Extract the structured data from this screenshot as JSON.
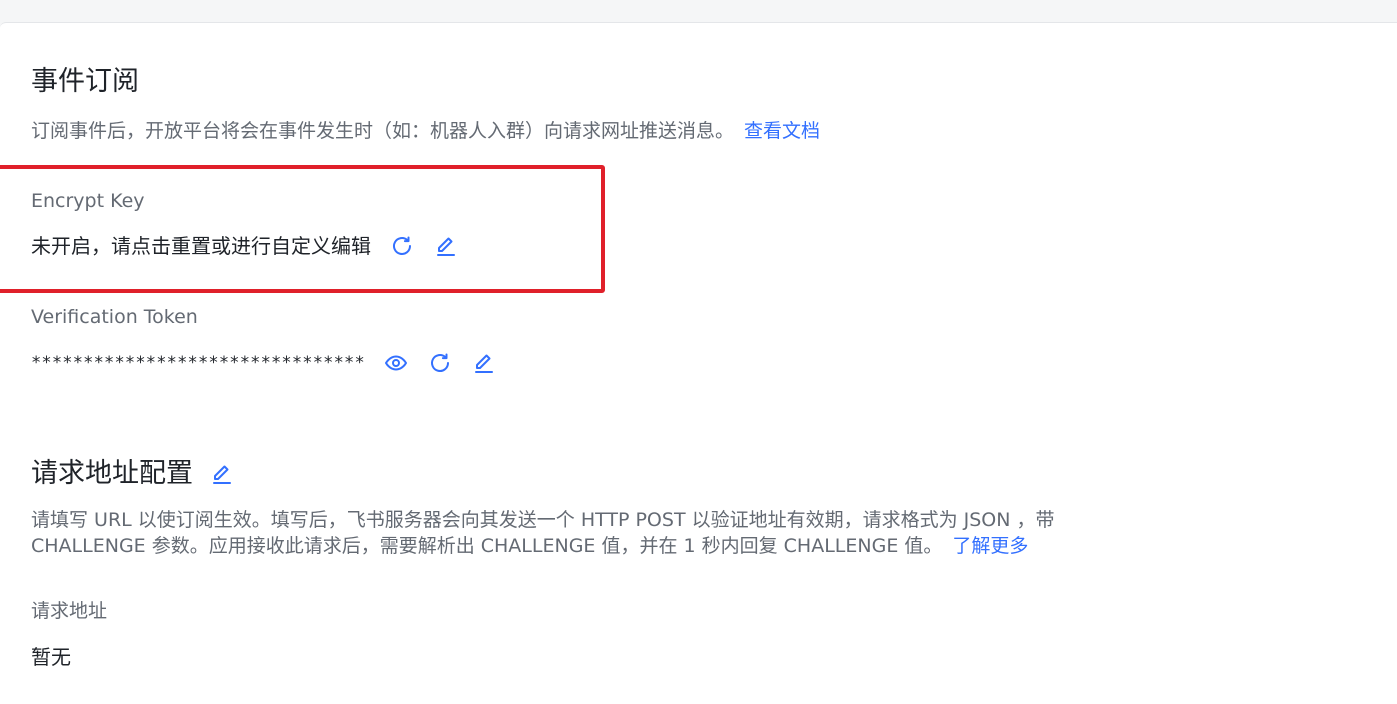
{
  "event_section": {
    "title": "事件订阅",
    "description": "订阅事件后，开放平台将会在事件发生时（如：机器人入群）向请求网址推送消息。",
    "doc_link": "查看文档"
  },
  "encrypt_key": {
    "label": "Encrypt Key",
    "value": "未开启，请点击重置或进行自定义编辑"
  },
  "verification_token": {
    "label": "Verification Token",
    "value": "********************************"
  },
  "request_section": {
    "title": "请求地址配置",
    "description_line1": "请填写 URL 以使订阅生效。填写后，飞书服务器会向其发送一个 HTTP POST 以验证地址有效期，请求格式为 JSON ，带",
    "description_line2": "CHALLENGE 参数。应用接收此请求后，需要解析出 CHALLENGE 值，并在 1 秒内回复 CHALLENGE 值。",
    "learn_more_link": "了解更多",
    "url_label": "请求地址",
    "url_value": "暂无"
  },
  "colors": {
    "accent": "#3370ff",
    "highlight_border": "#e0202a",
    "text_primary": "#1f2329",
    "text_secondary": "#646a73"
  },
  "icons": [
    "refresh-icon",
    "edit-icon",
    "eye-icon"
  ]
}
